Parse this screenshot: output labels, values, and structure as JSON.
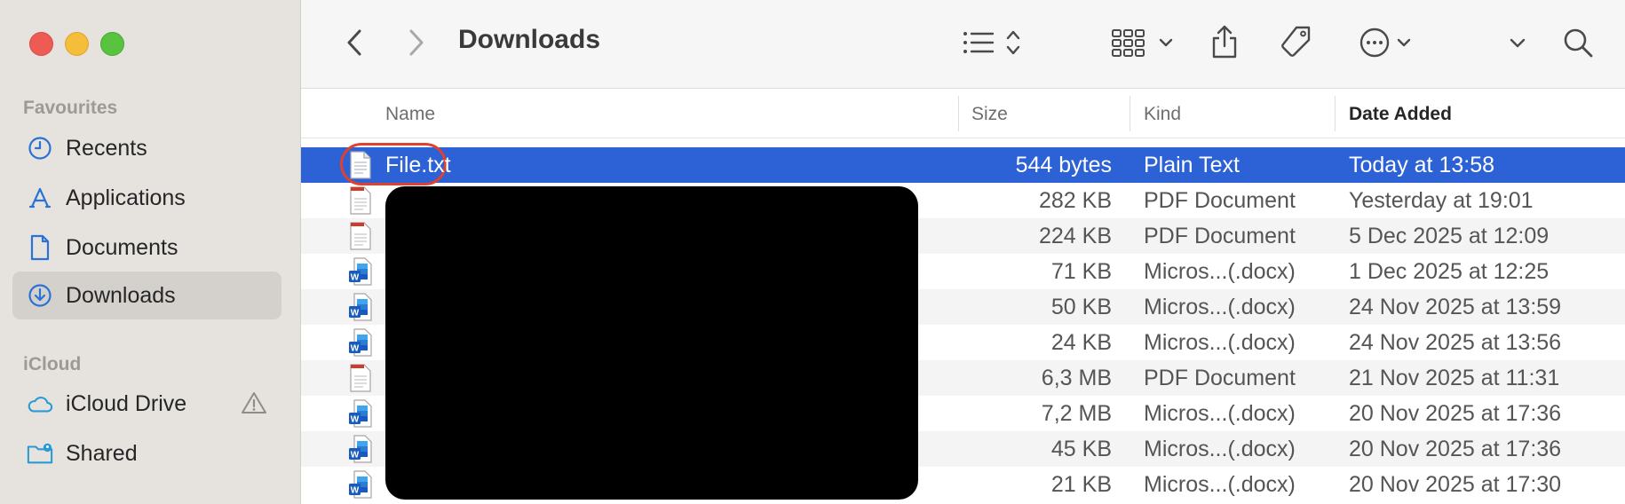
{
  "window": {
    "title": "Downloads",
    "colors": {
      "selection": "#2c62d6",
      "highlight_ring": "#e0412f",
      "sidebar": "#e6e3df"
    }
  },
  "sidebar": {
    "favourites_title": "Favourites",
    "favourites": [
      {
        "label": "Recents",
        "icon": "clock-icon"
      },
      {
        "label": "Applications",
        "icon": "applications-icon"
      },
      {
        "label": "Documents",
        "icon": "document-icon"
      },
      {
        "label": "Downloads",
        "icon": "download-icon",
        "active": true
      }
    ],
    "icloud_title": "iCloud",
    "icloud": [
      {
        "label": "iCloud Drive",
        "icon": "cloud-icon",
        "warning": true
      },
      {
        "label": "Shared",
        "icon": "shared-folder-icon"
      }
    ]
  },
  "columns": {
    "name": "Name",
    "size": "Size",
    "kind": "Kind",
    "date": "Date Added"
  },
  "files": [
    {
      "name": "File.txt",
      "size": "544 bytes",
      "kind": "Plain Text",
      "date": "Today at 13:58",
      "icon": "text-file-icon",
      "selected": true
    },
    {
      "name": "",
      "size": "282 KB",
      "kind": "PDF Document",
      "date": "Yesterday at 19:01",
      "icon": "pdf-file-icon"
    },
    {
      "name": "",
      "size": "224 KB",
      "kind": "PDF Document",
      "date": "5 Dec 2025 at 12:09",
      "icon": "pdf-file-icon"
    },
    {
      "name": "",
      "size": "71 KB",
      "kind": "Micros...(.docx)",
      "date": "1 Dec 2025 at 12:25",
      "icon": "word-file-icon"
    },
    {
      "name": "",
      "size": "50 KB",
      "kind": "Micros...(.docx)",
      "date": "24 Nov 2025 at 13:59",
      "icon": "word-file-icon"
    },
    {
      "name": "",
      "size": "24 KB",
      "kind": "Micros...(.docx)",
      "date": "24 Nov 2025 at 13:56",
      "icon": "word-file-icon"
    },
    {
      "name": "",
      "size": "6,3 MB",
      "kind": "PDF Document",
      "date": "21 Nov 2025 at 11:31",
      "icon": "pdf-file-icon"
    },
    {
      "name": "",
      "size": "7,2 MB",
      "kind": "Micros...(.docx)",
      "date": "20 Nov 2025 at 17:36",
      "icon": "word-file-icon"
    },
    {
      "name": "",
      "size": "45 KB",
      "kind": "Micros...(.docx)",
      "date": "20 Nov 2025 at 17:36",
      "icon": "word-file-icon"
    },
    {
      "name": "",
      "size": "21 KB",
      "kind": "Micros...(.docx)",
      "date": "20 Nov 2025 at 17:30",
      "icon": "word-file-icon"
    }
  ]
}
